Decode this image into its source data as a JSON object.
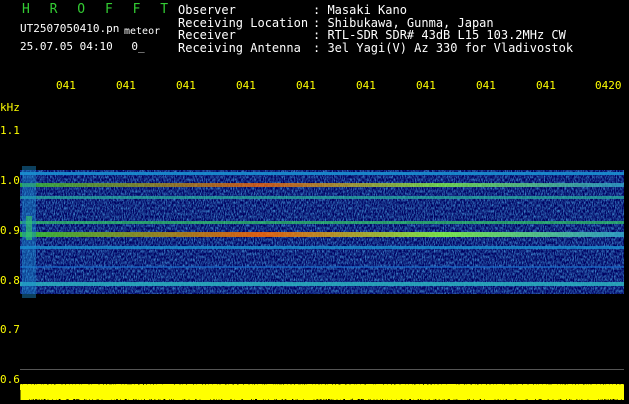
{
  "header": {
    "brand": "H R O F F T",
    "file_name": "UT2507050410.pn",
    "meteor_label": "meteor",
    "datetime": "25.07.05 04:10",
    "count": "0_"
  },
  "info": [
    {
      "label": "Observer",
      "value": ": Masaki Kano"
    },
    {
      "label": "Receiving Location",
      "value": ": Shibukawa, Gunma, Japan"
    },
    {
      "label": "Receiver",
      "value": ": RTL-SDR SDR# 43dB L15 103.2MHz CW"
    },
    {
      "label": "Receiving Antenna",
      "value": ": 3el Yagi(V) Az 330 for Vladivostok"
    }
  ],
  "time_ticks": [
    "041",
    "041",
    "041",
    "041",
    "041",
    "041",
    "041",
    "041",
    "041",
    "0420"
  ],
  "y_axis": {
    "unit": "kHz",
    "labels": [
      "1.1",
      "1.0",
      "0.9",
      "0.8",
      "0.7",
      "0.6"
    ]
  },
  "colors": {
    "background": "#000000",
    "header_green": "#33cc33",
    "text_yellow": "#ffff00",
    "text_white": "#ffffff",
    "spectrogram_base": "#000080",
    "signal_high": "#ff3300",
    "power_strip": "#ffff00"
  }
}
